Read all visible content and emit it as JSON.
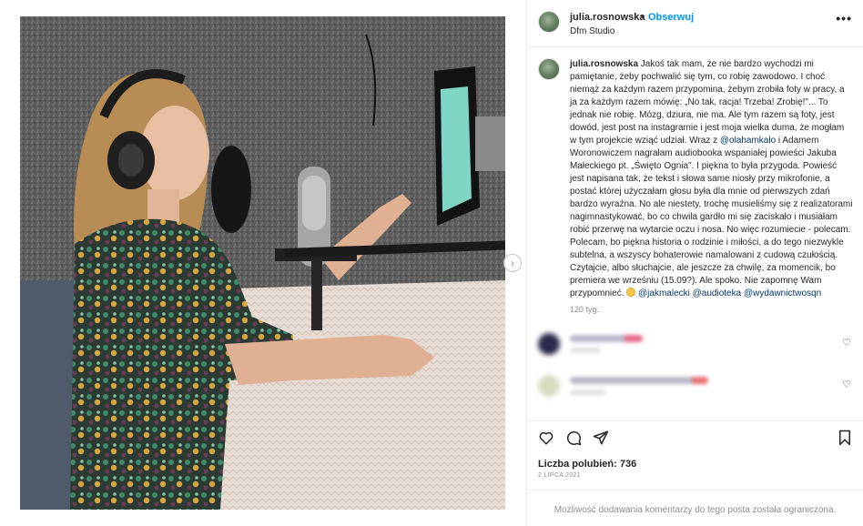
{
  "post": {
    "username": "julia.rosnowska",
    "separator": "•",
    "follow_label": "Obserwuj",
    "location": "Dfm Studio",
    "more_label": "•••"
  },
  "caption": {
    "username": "julia.rosnowska",
    "text_1": " Jakoś tak mam, że nie bardzo wychodzi mi pamiętanie, żeby pochwalić się tym, co robię zawodowo. I choć niemąż za każdym razem przypomina, żebym zrobiła foty w pracy, a ja za każdym razem mówię: „No tak, racja! Trzeba! Zrobię!\"... To jednak nie robię. Mózg, dziura, nie ma. Ale tym razem są foty, jest dowód, jest post na instagramie i jest moja wielka duma, że mogłam w tym projekcie wziąć udział. Wraz z ",
    "mention_1": "@olahamkalo",
    "text_2": " i Adamem Woronowiczem nagrałam audiobooka wspaniałej powieści Jakuba Małeckiego pt. „Święto Ognia\". I piękna to była przygoda. Powieść jest napisana tak, że tekst i słowa same niosły przy mikrofonie, a postać której użyczałam głosu była dla mnie od pierwszych zdań bardzo wyraźna. No ale niestety, trochę musieliśmy się z realizatorami nagimnastykować, bo co chwila gardło mi się zaciskało i musiałam robić przerwę na wytarcie oczu i nosa. No więc rozumiecie - polecam. Polecam, bo piękna historia o rodzinie i miłości, a do tego niezwykle subtelna, a wszyscy bohaterowie namalowani z cudową czułością. Czytajcie, albo słuchajcie, ale jeszcze za chwilę, za momencik, bo premiera we wrześniu (15.09?). Ale spoko. Nie zapomnę Wam przypomnieć. ",
    "mention_2": "@jakmalecki",
    "mention_3": "@audioteka",
    "mention_4": "@wydawnictwosqn",
    "time_ago": "120 tyg."
  },
  "stats": {
    "likes": "Liczba polubień: 736",
    "date": "2 LIPCA 2021"
  },
  "footer": {
    "comments_closed": "Możliwość dodawania komentarzy do tego posta została ograniczona."
  },
  "colors": {
    "accent": "#0095f6",
    "mention": "#00376b",
    "muted": "#8e8e8e"
  },
  "icons": [
    "more-icon",
    "heart-icon",
    "comment-icon",
    "share-icon",
    "bookmark-icon",
    "chevron-right-icon"
  ]
}
